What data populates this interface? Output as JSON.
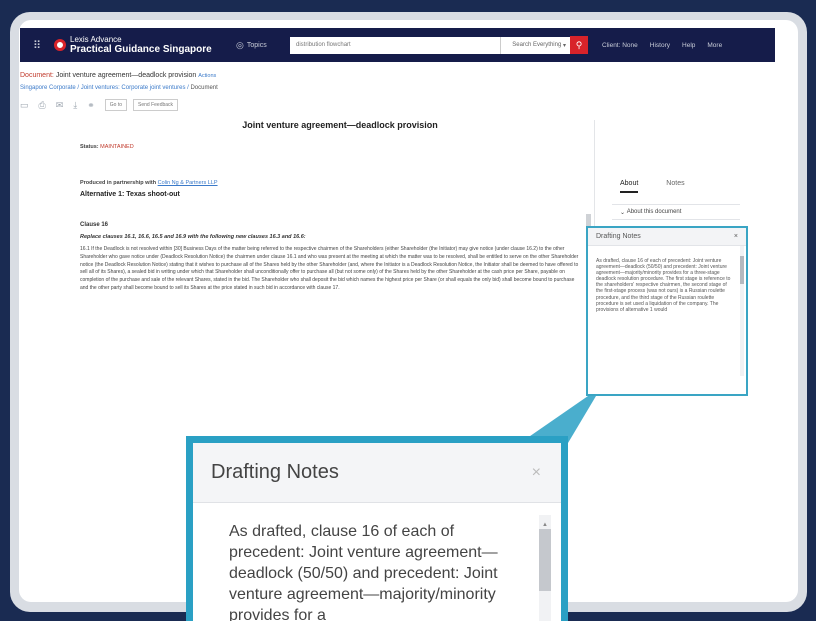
{
  "navbar": {
    "logo_line1": "Lexis Advance",
    "logo_line2": "Practical Guidance Singapore",
    "topics_label": "Topics",
    "search_value": "distribution flowchart",
    "search_scope": "Search Everything",
    "links": [
      "Client: None",
      "History",
      "Help",
      "More"
    ]
  },
  "document": {
    "title_label": "Document:",
    "title": "Joint venture agreement—deadlock provision",
    "actions": "Actions",
    "breadcrumb": [
      "Singapore Corporate",
      "Joint ventures: Corporate joint ventures"
    ],
    "breadcrumb_current": "Document",
    "toolbar_buttons": [
      "Go to",
      "Send Feedback"
    ],
    "heading": "Joint venture agreement—deadlock provision",
    "status_label": "Status:",
    "status_value": "MAINTAINED",
    "partner_label": "Produced in partnership with",
    "partner_link": "Colin Ng & Partners LLP",
    "alternative": "Alternative 1: Texas shoot-out",
    "clause": "Clause 16",
    "replace_text": "Replace clauses 16.1, 16.6, 16.5 and 16.9 with the following new clauses 16.3 and 16.6:",
    "paragraph": "16.1 If the Deadlock is not resolved within [30] Business Days of the matter being referred to the respective chairmen of the Shareholders (either Shareholder (the Initiator) may give notice (under clause 16.2) to the other Shareholder who gave notice under (Deadlock Resolution Notice) the chairmen under clause 16.1 and who was present at the meeting at which the matter was to be resolved, shall be entitled to serve on the other Shareholder notice (the Deadlock Resolution Notice) stating that it wishes to purchase all of the Shares held by the other Shareholder (and, where the Initiator is a Deadlock Resolution Notice, the Initiator shall be deemed to have offered to sell all of its Shares), a sealed bid in writing under which that Shareholder shall unconditionally offer to purchase all (but not some only) of the Shares held by the other Shareholder at the cash price per Share, payable on completion of the purchase and sale of the relevant Shares, stated in the bid. The Shareholder who shall deposit the bid which names the highest price per Share (or shall equals the only bid) shall become bound to purchase and the other party shall become bound to sell its Shares at the price stated in such bid in accordance with clause 17."
  },
  "panel": {
    "tabs": [
      "About",
      "Notes"
    ],
    "about_row": "About this document",
    "notes_title": "Drafting Notes",
    "notes_text": "As drafted, clause 16 of each of precedent: Joint venture agreement—deadlock (50/50) and precedent: Joint venture agreement—majority/minority provides for a three-stage deadlock resolution procedure. The first stage is reference to the shareholders' respective chairmen, the second stage of the first-stage process (was not ours) is a Russian roulette procedure, and the third stage of the Russian roulette procedure is set used a liquidation of the company. The provisions of alternative 1 would"
  },
  "callout": {
    "title": "Drafting Notes",
    "close": "×",
    "text": "As drafted, clause 16 of each of precedent: Joint venture agreement—deadlock (50/50) and precedent: Joint venture agreement—majority/minority provides for a"
  },
  "icons": {
    "grid": "grid-icon",
    "topics": "topics-icon",
    "search": "search-icon",
    "close": "close-icon"
  },
  "colors": {
    "background": "#1a2b52",
    "navbar": "#151c4a",
    "accent_red": "#d8232a",
    "callout_border": "#2aa0c4"
  }
}
